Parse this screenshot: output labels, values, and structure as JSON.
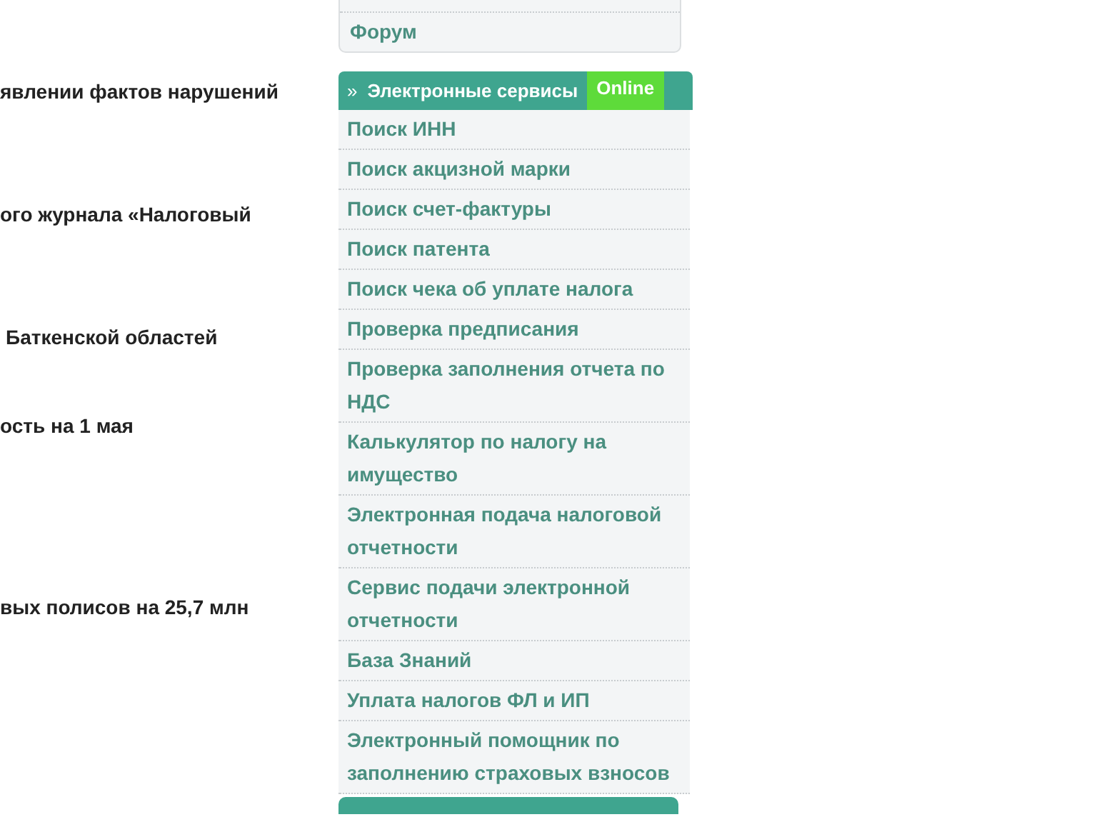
{
  "news": [
    "явлении фактов нарушений",
    "ого журнала «Налоговый",
    "Баткенской областей",
    "ость на 1 мая",
    "вых полисов на 25,7 млн"
  ],
  "top_menu": {
    "items": [
      "Форум"
    ]
  },
  "services": {
    "marker": "»",
    "title": "Электронные сервисы",
    "badge": "Online",
    "items": [
      "Поиск ИНН",
      "Поиск акцизной марки",
      "Поиск счет-фактуры",
      "Поиск патента",
      "Поиск чека об уплате налога",
      "Проверка предписания",
      "Проверка заполнения отчета по НДС",
      "Калькулятор по налогу на имущество",
      "Электронная подача налоговой отчетности",
      "Сервис подачи электронной отчетности",
      "База Знаний",
      "Уплата налогов ФЛ и ИП",
      "Электронный помощник по заполнению страховых взносов"
    ]
  }
}
